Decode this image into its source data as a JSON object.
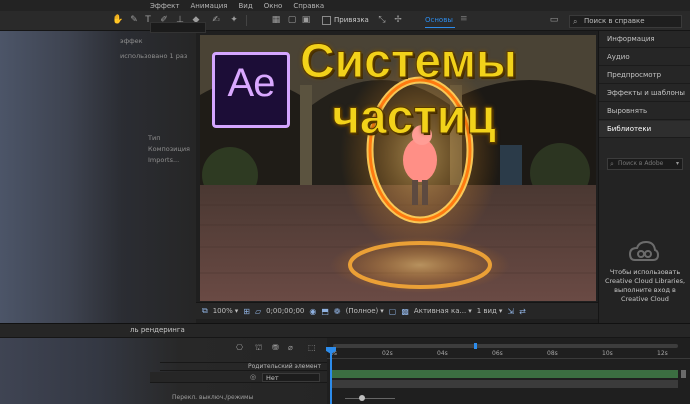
{
  "menubar": {
    "items": [
      "Эффект",
      "Анимация",
      "Вид",
      "Окно",
      "Справка"
    ]
  },
  "toolbar": {
    "snap_label": "Привязка",
    "workspace_label": "Основы",
    "search_placeholder": "Поиск в справке"
  },
  "project_panel": {
    "partial_lines": [
      "эффек",
      "использовано 1 раз",
      "Тип",
      "Композиция",
      "Imports..."
    ]
  },
  "viewer": {
    "zoom": "100%",
    "timecode": "0;00;00;00",
    "resolution": "(Полное)",
    "camera": "Активная ка...",
    "views": "1 вид"
  },
  "right_panel": {
    "items": [
      {
        "label": "Информация"
      },
      {
        "label": "Аудио"
      },
      {
        "label": "Предпросмотр"
      },
      {
        "label": "Эффекты и шаблоны"
      },
      {
        "label": "Выровнять"
      },
      {
        "label": "Библиотеки",
        "active": true
      }
    ],
    "library_search_placeholder": "Поиск в Adobe",
    "library_message": "Чтобы использовать Creative Cloud Libraries, выполните вход в Creative Cloud"
  },
  "timeline": {
    "tab_label": "ль рендеринга",
    "parent_column": "Родительский элемент",
    "parent_value": "Нет",
    "bottom_toggle": "Перекл. выключ./режимы",
    "ruler": [
      "0s",
      "02s",
      "04s",
      "06s",
      "08s",
      "10s",
      "12s"
    ]
  },
  "overlay": {
    "logo_text": "Ae",
    "title_line1": "Системы",
    "title_line2": "частиц"
  },
  "colors": {
    "accent_blue": "#2d8ceb",
    "title_yellow": "#f2d21a",
    "ae_purple": "#d9a8ff",
    "ae_bg": "#1c0d37"
  }
}
